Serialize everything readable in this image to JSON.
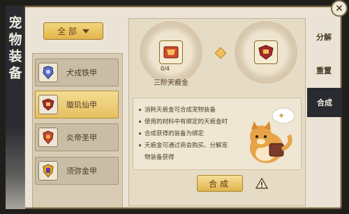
{
  "window": {
    "title_chars": [
      "宠",
      "物",
      "装",
      "备"
    ],
    "close_glyph": "×"
  },
  "filter": {
    "selected": "全 部"
  },
  "equipment_list": [
    {
      "label": "犬戎铁甲",
      "icon": "armor-blue-icon",
      "selected": false
    },
    {
      "label": "璇玑仙甲",
      "icon": "armor-gold-red-icon",
      "selected": true
    },
    {
      "label": "炎帝圣甲",
      "icon": "armor-red-icon",
      "selected": false
    },
    {
      "label": "须弥金甲",
      "icon": "armor-gold-icon",
      "selected": false
    }
  ],
  "synthesis": {
    "material_label": "三阶天痕金",
    "material_count": "0/4",
    "notes": [
      "消耗天痕金可合成宠物装备",
      "使用的材料中有绑定的天痕金时",
      "合成获得的装备为绑定",
      "天痕金可通过商会购买、分解宠",
      "物装备获得"
    ],
    "compose_button": "合成"
  },
  "tabs": [
    {
      "label": "分解",
      "active": false
    },
    {
      "label": "重置",
      "active": false
    },
    {
      "label": "合成",
      "active": true
    }
  ],
  "colors": {
    "panel": "#ebe4d6",
    "accent_gold": "#e3b44d",
    "dark_tab": "#2a2b30"
  }
}
